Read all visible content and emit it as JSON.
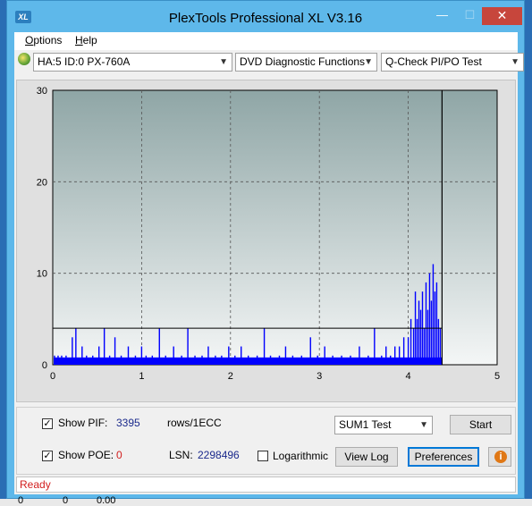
{
  "window": {
    "title": "PlexTools Professional XL V3.16",
    "app_icon_text": "XL",
    "min_symbol": "—",
    "max_symbol": "☐",
    "close_symbol": "✕"
  },
  "menu": {
    "items": [
      {
        "label": "Options",
        "accel": "O",
        "rest": "ptions"
      },
      {
        "label": "Help",
        "accel": "H",
        "rest": "elp"
      }
    ]
  },
  "toolbar": {
    "drive": "HA:5 ID:0  PX-760A",
    "function": "DVD Diagnostic Functions",
    "test": "Q-Check PI/PO Test"
  },
  "chart_data": {
    "type": "bar",
    "xlim": [
      0,
      5
    ],
    "ylim": [
      0,
      30
    ],
    "x_ticks": [
      "0",
      "1",
      "2",
      "3",
      "4",
      "5"
    ],
    "y_ticks": [
      "0",
      "10",
      "20",
      "30"
    ],
    "grid": true,
    "threshold_line": 4,
    "end_marker_x": 4.38,
    "baseline_level": 0.8,
    "series": [
      {
        "color": "#0000ff",
        "x": [
          0.02,
          0.06,
          0.1,
          0.15,
          0.22,
          0.26,
          0.33,
          0.38,
          0.45,
          0.52,
          0.58,
          0.64,
          0.7,
          0.77,
          0.85,
          0.93,
          1.0,
          1.05,
          1.12,
          1.2,
          1.27,
          1.36,
          1.45,
          1.52,
          1.6,
          1.68,
          1.75,
          1.83,
          1.9,
          1.98,
          2.05,
          2.12,
          2.2,
          2.3,
          2.38,
          2.45,
          2.55,
          2.62,
          2.7,
          2.8,
          2.9,
          2.98,
          3.06,
          3.15,
          3.25,
          3.35,
          3.45,
          3.55,
          3.62,
          3.7,
          3.75,
          3.8,
          3.85,
          3.9,
          3.95,
          4.0,
          4.03,
          4.06,
          4.08,
          4.1,
          4.12,
          4.14,
          4.16,
          4.18,
          4.2,
          4.22,
          4.24,
          4.26,
          4.28,
          4.3,
          4.32,
          4.34,
          4.36
        ],
        "values": [
          1,
          1,
          1,
          1,
          3,
          4,
          2,
          1,
          1,
          2,
          4,
          1,
          3,
          1,
          2,
          1,
          2,
          1,
          1,
          4,
          1,
          2,
          1,
          4,
          1,
          1,
          2,
          1,
          1,
          2,
          1,
          2,
          1,
          1,
          4,
          1,
          1,
          2,
          1,
          1,
          3,
          1,
          2,
          1,
          1,
          1,
          2,
          1,
          4,
          1,
          2,
          1,
          2,
          2,
          3,
          3,
          5,
          4,
          8,
          5,
          7,
          6,
          8,
          4,
          9,
          6,
          10,
          7,
          11,
          8,
          9,
          5,
          4
        ]
      }
    ]
  },
  "controls": {
    "show_pif_label": "Show PIF:",
    "pif_value": "3395",
    "pif_unit": "rows/1ECC",
    "show_poe_label": "Show POE:",
    "poe_value": "0",
    "lsn_label": "LSN:",
    "lsn_value": "2298496",
    "logarithmic_label": "Logarithmic",
    "sum_test": "SUM1 Test",
    "start_label": "Start",
    "view_log_label": "View Log",
    "preferences_label": "Preferences",
    "info_symbol": "i",
    "check_mark": "✓"
  },
  "status": {
    "text": "Ready"
  },
  "bottom_strip": {
    "values": [
      "0",
      "0",
      "0.00"
    ]
  }
}
